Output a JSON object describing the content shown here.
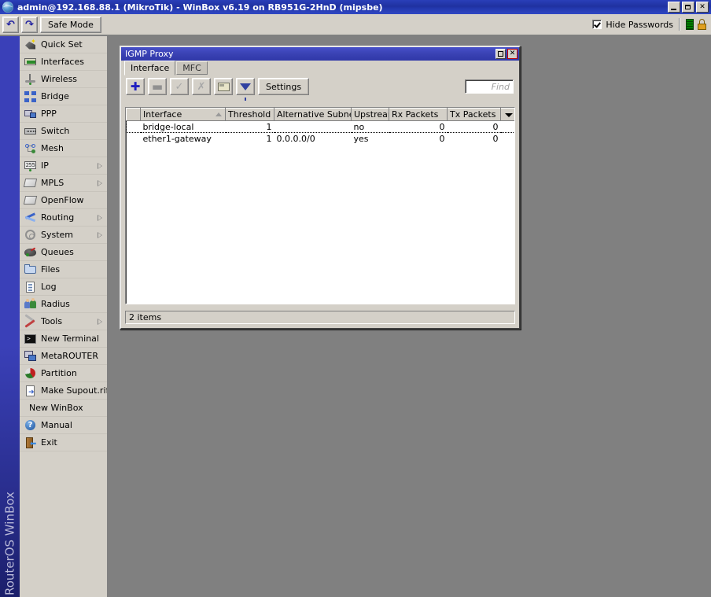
{
  "window": {
    "title": "admin@192.168.88.1 (MikroTik) - WinBox v6.19 on RB951G-2HnD (mipsbe)",
    "app_icon": "globe-icon",
    "minimize_label": "_",
    "restore_label": "❐",
    "close_label": "✕"
  },
  "toolbar": {
    "undo_icon": "undo-arrow-icon",
    "undo_glyph": "↶",
    "redo_icon": "redo-arrow-icon",
    "redo_glyph": "↷",
    "safe_mode_label": "Safe Mode",
    "hide_passwords_label": "Hide Passwords",
    "hide_passwords_checked": true,
    "status_bars_icon": "signal-bars-icon",
    "lock_icon": "lock-icon"
  },
  "sidebar": {
    "brand_label": "RouterOS WinBox",
    "items": [
      {
        "label": "Quick Set",
        "icon": "wand-icon",
        "submenu": false
      },
      {
        "label": "Interfaces",
        "icon": "nic-card-icon",
        "submenu": false
      },
      {
        "label": "Wireless",
        "icon": "antenna-icon",
        "submenu": false
      },
      {
        "label": "Bridge",
        "icon": "bridge-icon",
        "submenu": false
      },
      {
        "label": "PPP",
        "icon": "ppp-icon",
        "submenu": false
      },
      {
        "label": "Switch",
        "icon": "switch-icon",
        "submenu": false
      },
      {
        "label": "Mesh",
        "icon": "mesh-icon",
        "submenu": false
      },
      {
        "label": "IP",
        "icon": "ip-icon",
        "submenu": true
      },
      {
        "label": "MPLS",
        "icon": "mpls-tag-icon",
        "submenu": true
      },
      {
        "label": "OpenFlow",
        "icon": "openflow-icon",
        "submenu": false
      },
      {
        "label": "Routing",
        "icon": "routing-icon",
        "submenu": true
      },
      {
        "label": "System",
        "icon": "gear-icon",
        "submenu": true
      },
      {
        "label": "Queues",
        "icon": "queues-icon",
        "submenu": false
      },
      {
        "label": "Files",
        "icon": "folder-icon",
        "submenu": false
      },
      {
        "label": "Log",
        "icon": "log-document-icon",
        "submenu": false
      },
      {
        "label": "Radius",
        "icon": "radius-users-icon",
        "submenu": false
      },
      {
        "label": "Tools",
        "icon": "tools-icon",
        "submenu": true
      },
      {
        "label": "New Terminal",
        "icon": "terminal-icon",
        "submenu": false
      },
      {
        "label": "MetaROUTER",
        "icon": "metarouter-icon",
        "submenu": false
      },
      {
        "label": "Partition",
        "icon": "pie-chart-icon",
        "submenu": false
      },
      {
        "label": "Make Supout.rif",
        "icon": "supout-file-icon",
        "submenu": false
      },
      {
        "label": "New WinBox",
        "icon": "",
        "submenu": false
      },
      {
        "label": "Manual",
        "icon": "help-icon",
        "submenu": false
      },
      {
        "label": "Exit",
        "icon": "exit-door-icon",
        "submenu": false
      }
    ]
  },
  "igmp_window": {
    "title": "IGMP Proxy",
    "restore_label": "□",
    "close_label": "✕",
    "tabs": [
      {
        "label": "Interface",
        "active": true
      },
      {
        "label": "MFC",
        "active": false
      }
    ],
    "toolbar": {
      "add_glyph": "✚",
      "add_name": "add-button",
      "remove_glyph": "➖",
      "remove_name": "remove-button",
      "enable_glyph": "✓",
      "enable_name": "enable-button",
      "disable_glyph": "✗",
      "disable_name": "disable-button",
      "comment_name": "comment-button",
      "filter_name": "filter-button",
      "settings_label": "Settings"
    },
    "find_placeholder": "Find",
    "table": {
      "columns": [
        {
          "label": "Interface",
          "sorted": true
        },
        {
          "label": "Threshold",
          "sorted": false
        },
        {
          "label": "Alternative Subnets",
          "sorted": false
        },
        {
          "label": "Upstream",
          "sorted": false
        },
        {
          "label": "Rx Packets",
          "sorted": false
        },
        {
          "label": "Tx Packets",
          "sorted": false
        }
      ],
      "rows": [
        {
          "flag": "",
          "interface": "bridge-local",
          "threshold": "1",
          "alternative_subnets": "",
          "upstream": "no",
          "rx_packets": "0",
          "tx_packets": "0",
          "focused": true
        },
        {
          "flag": "",
          "interface": "ether1-gateway",
          "threshold": "1",
          "alternative_subnets": "0.0.0.0/0",
          "upstream": "yes",
          "rx_packets": "0",
          "tx_packets": "0",
          "focused": false
        }
      ]
    },
    "status_text": "2 items"
  },
  "colors": {
    "titlebar_blue": "#2a3fb8",
    "sidebar_blue": "#3a40b8",
    "desktop_gray": "#808080",
    "chrome_gray": "#d4d0c8",
    "accent_plus": "#2020c0"
  }
}
